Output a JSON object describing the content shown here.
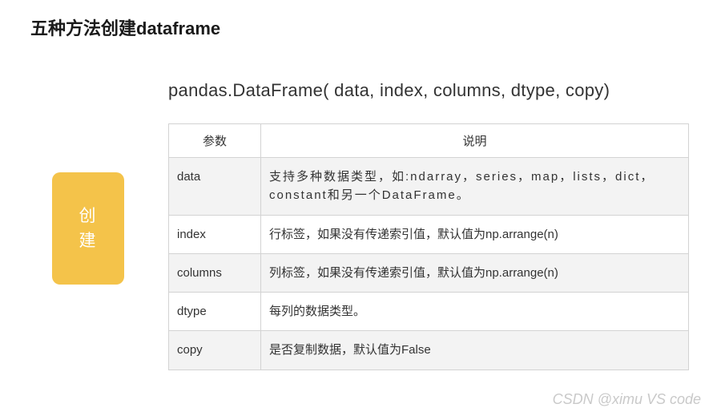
{
  "title": "五种方法创建dataframe",
  "badge": {
    "line1": "创",
    "line2": "建"
  },
  "signature": "pandas.DataFrame( data, index, columns, dtype, copy)",
  "table": {
    "headers": {
      "param": "参数",
      "desc": "说明"
    },
    "rows": [
      {
        "param": "data",
        "desc": "支持多种数据类型，如:ndarray，series，map，lists，dict，constant和另一个DataFrame。"
      },
      {
        "param": "index",
        "desc": "行标签，如果没有传递索引值，默认值为np.arrange(n)"
      },
      {
        "param": "columns",
        "desc": "列标签，如果没有传递索引值，默认值为np.arrange(n)"
      },
      {
        "param": "dtype",
        "desc": "每列的数据类型。"
      },
      {
        "param": "copy",
        "desc": "是否复制数据，默认值为False"
      }
    ]
  },
  "watermark": "CSDN @ximu VS code"
}
